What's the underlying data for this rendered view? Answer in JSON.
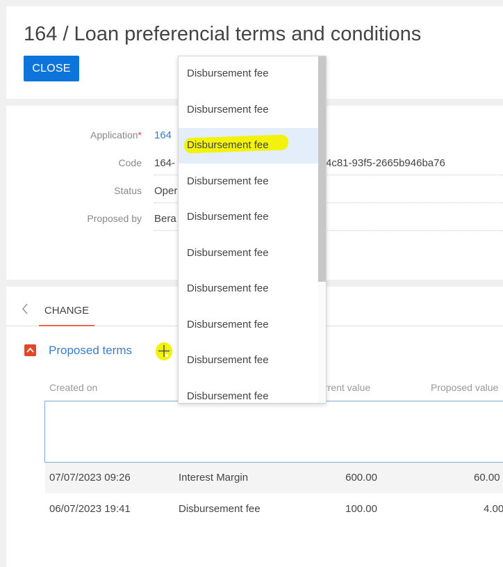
{
  "header": {
    "title": "164 / Loan preferencial terms and conditions",
    "close_label": "CLOSE"
  },
  "info": {
    "application": {
      "label": "Application",
      "value": "164"
    },
    "code": {
      "label": "Code",
      "value": "164-",
      "suffix": "4c81-93f5-2665b946ba76"
    },
    "status": {
      "label": "Status",
      "value": "Oper"
    },
    "proposed_by": {
      "label": "Proposed by",
      "value": "Bera"
    }
  },
  "tabs": {
    "change_label": "CHANGE"
  },
  "proposed_terms": {
    "title": "Proposed terms",
    "columns": {
      "created_on": "Created on",
      "current_value": "rrent value",
      "proposed_value": "Proposed value"
    },
    "rows": [
      {
        "created_on": "07/07/2023 09:26",
        "term": "Interest Margin",
        "current": "600.00",
        "proposed": "60.00"
      },
      {
        "created_on": "06/07/2023 19:41",
        "term": "Disbursement fee",
        "current": "100.00",
        "proposed": "4.00"
      }
    ]
  },
  "dropdown": {
    "items": [
      "Disbursement fee",
      "Disbursement fee",
      "Disbursement fee",
      "Disbursement fee",
      "Disbursement fee",
      "Disbursement fee",
      "Disbursement fee",
      "Disbursement fee",
      "Disbursement fee",
      "Disbursement fee"
    ],
    "selected_index": 2
  },
  "colors": {
    "accent_blue": "#0d74db",
    "link_blue": "#3a7cc8",
    "tab_underline": "#e76b4a",
    "collapse_red": "#e2462b",
    "highlight_yellow": "#f2f20a",
    "selected_bg": "#e4edfa"
  }
}
